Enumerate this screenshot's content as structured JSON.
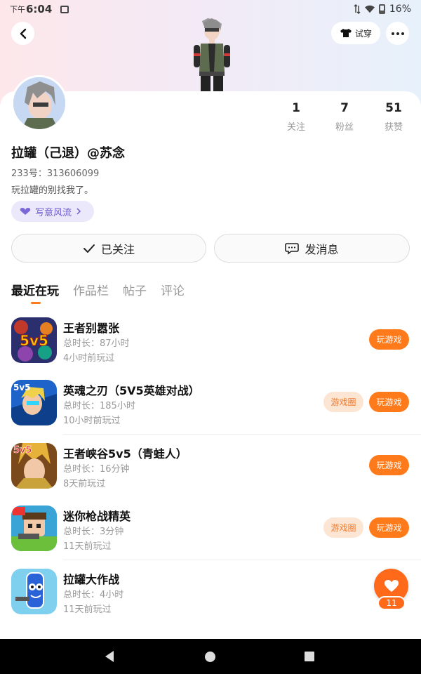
{
  "status_bar": {
    "ampm": "下午",
    "time": "6:04",
    "battery": "16%"
  },
  "header": {
    "try_on_label": "试穿"
  },
  "profile": {
    "name": "拉罐（己退）@苏念",
    "uid": "233号：313606099",
    "bio": "玩拉罐的别找我了。",
    "tag_label": "写意风流",
    "stats": [
      {
        "value": "1",
        "label": "关注"
      },
      {
        "value": "7",
        "label": "粉丝"
      },
      {
        "value": "51",
        "label": "获赞"
      }
    ]
  },
  "actions": {
    "follow_label": "已关注",
    "message_label": "发消息"
  },
  "tabs": [
    {
      "label": "最近在玩",
      "active": true
    },
    {
      "label": "作品栏",
      "active": false
    },
    {
      "label": "帖子",
      "active": false
    },
    {
      "label": "评论",
      "active": false
    }
  ],
  "games": [
    {
      "title": "王者别嚣张",
      "duration": "总时长：87小时",
      "ago": "4小时前玩过",
      "circle": "",
      "play": "玩游戏"
    },
    {
      "title": "英魂之刃（5V5英雄对战）",
      "duration": "总时长：185小时",
      "ago": "10小时前玩过",
      "circle": "游戏圈",
      "play": "玩游戏"
    },
    {
      "title": "王者峡谷5v5（青蛙人）",
      "duration": "总时长：16分钟",
      "ago": "8天前玩过",
      "circle": "",
      "play": "玩游戏"
    },
    {
      "title": "迷你枪战精英",
      "duration": "总时长：3分钟",
      "ago": "11天前玩过",
      "circle": "游戏圈",
      "play": "玩游戏"
    },
    {
      "title": "拉罐大作战",
      "duration": "总时长：4小时",
      "ago": "11天前玩过",
      "circle": "",
      "play": ""
    }
  ],
  "game_icon_texts": {
    "g1": "5v5",
    "g2": "5v5",
    "g3": "5v5"
  },
  "fab": {
    "count": "11"
  },
  "colors": {
    "accent": "#ff7a1a",
    "tag_bg": "#ece8fb",
    "tag_text": "#6d5bd0"
  }
}
